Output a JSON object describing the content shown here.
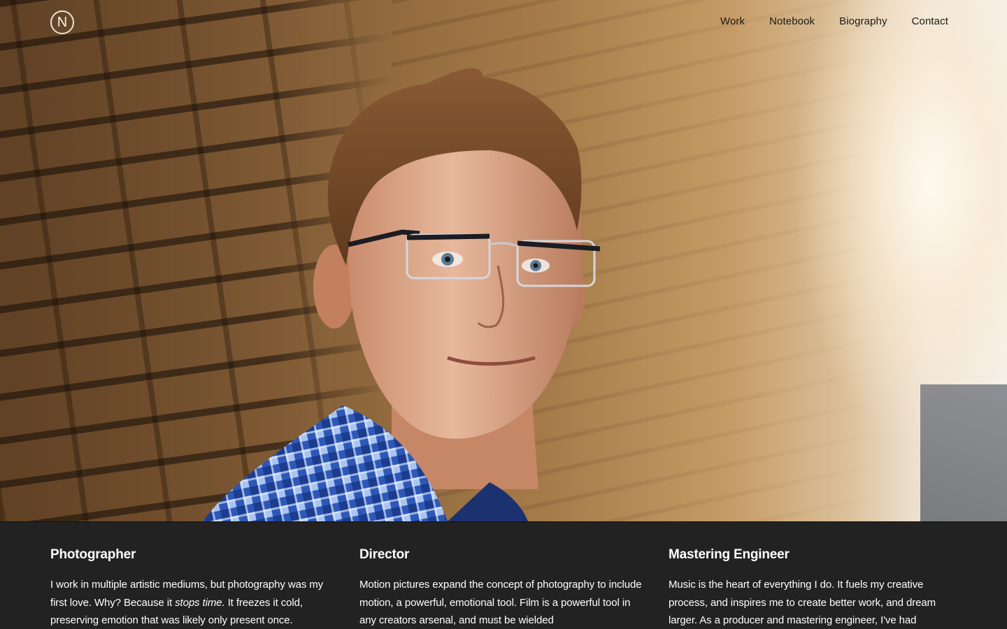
{
  "header": {
    "logo_letter": "N",
    "nav": [
      {
        "label": "Work"
      },
      {
        "label": "Notebook"
      },
      {
        "label": "Biography"
      },
      {
        "label": "Contact"
      }
    ]
  },
  "columns": [
    {
      "title": "Photographer",
      "text_before": "I work in multiple artistic mediums, but photography was my first love. Why? Because it ",
      "text_em": "stops time.",
      "text_after": " It freezes it cold, preserving emotion that was likely only present once."
    },
    {
      "title": "Director",
      "text": "Motion pictures expand the concept of photography to include motion, a powerful, emotional tool. Film is a powerful tool in any creators arsenal, and must be wielded"
    },
    {
      "title": "Mastering Engineer",
      "text": "Music is the heart of everything I do. It fuels my creative process, and inspires me to create better work, and dream larger. As a producer and mastering engineer, I've had"
    }
  ],
  "colors": {
    "footer_bg": "#222222",
    "nav_text": "#1a1a1a",
    "heading_text": "#ffffff"
  }
}
